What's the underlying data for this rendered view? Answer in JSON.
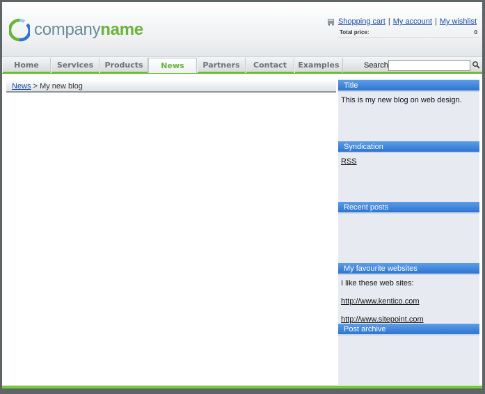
{
  "logo": {
    "part1": "company",
    "part2": "name"
  },
  "toplinks": {
    "shopping_cart": "Shopping cart",
    "my_account": "My account",
    "my_wishlist": "My wishlist",
    "separator": "|",
    "total_label": "Total price:",
    "total_value": "0"
  },
  "nav": {
    "items": [
      {
        "label": "Home"
      },
      {
        "label": "Services"
      },
      {
        "label": "Products"
      },
      {
        "label": "News"
      },
      {
        "label": "Partners"
      },
      {
        "label": "Contact"
      },
      {
        "label": "Examples"
      }
    ],
    "active": "News",
    "search_label": "Search:",
    "search_value": ""
  },
  "breadcrumb": {
    "link": "News",
    "separator": ">",
    "current": "My new blog"
  },
  "sidebar": {
    "title": {
      "heading": "Title",
      "text": "This is my new blog on web design."
    },
    "syndication": {
      "heading": "Syndication",
      "rss": "RSS"
    },
    "recent_posts": {
      "heading": "Recent posts"
    },
    "favourites": {
      "heading": "My favourite websites",
      "intro": "I like these web sites:",
      "links": [
        "http://www.kentico.com",
        "http://www.sitepoint.com"
      ]
    },
    "archive": {
      "heading": "Post archive"
    }
  },
  "colors": {
    "accent_green": "#6bb33a",
    "widget_blue": "#2f74cf",
    "link_blue": "#1a4ea3"
  }
}
